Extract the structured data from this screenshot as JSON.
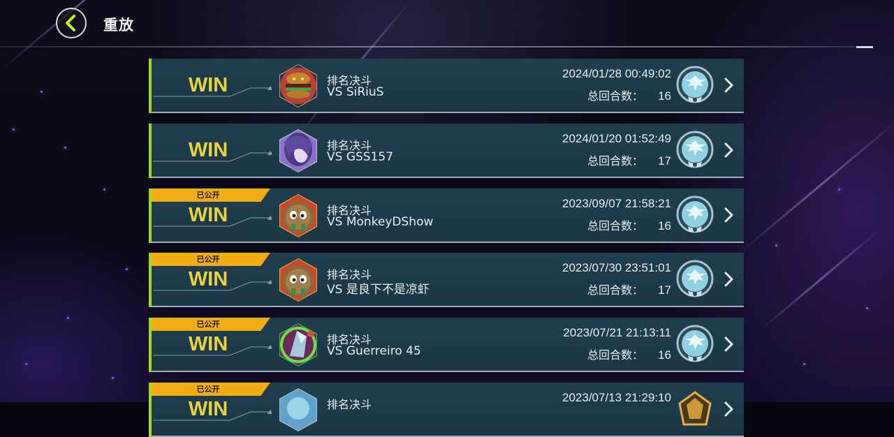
{
  "header": {
    "title": "重放"
  },
  "colors": {
    "accent_green": "#9fdc1a",
    "win_yellow": "#e8d33a",
    "tag_orange": "#f2ac14",
    "row_bg": "#1f3f4f"
  },
  "replays": [
    {
      "public_tag": "",
      "result": "WIN",
      "mode": "排名决斗",
      "opponent": "VS SiRiuS",
      "datetime": "2024/01/28 00:49:02",
      "turns_label": "总回合数：",
      "turns": "16",
      "avatar_icon": "burger-monster-avatar-icon",
      "rank_icon": "rank-emblem-icon"
    },
    {
      "public_tag": "",
      "result": "WIN",
      "mode": "排名决斗",
      "opponent": "VS GSS157",
      "datetime": "2024/01/20 01:52:49",
      "turns_label": "总回合数：",
      "turns": "17",
      "avatar_icon": "purple-girl-avatar-icon",
      "rank_icon": "rank-emblem-icon"
    },
    {
      "public_tag": "已公开",
      "result": "WIN",
      "mode": "排名决斗",
      "opponent": "VS MonkeyDShow",
      "datetime": "2023/09/07 21:58:21",
      "turns_label": "总回合数：",
      "turns": "16",
      "avatar_icon": "kuriboh-avatar-icon",
      "rank_icon": "rank-emblem-icon"
    },
    {
      "public_tag": "已公开",
      "result": "WIN",
      "mode": "排名决斗",
      "opponent": "VS 是良下不是凉虾",
      "datetime": "2023/07/30 23:51:01",
      "turns_label": "总回合数：",
      "turns": "17",
      "avatar_icon": "kuriboh-avatar-icon",
      "rank_icon": "rank-emblem-icon"
    },
    {
      "public_tag": "已公开",
      "result": "WIN",
      "mode": "排名决斗",
      "opponent": "VS Guerreiro 45",
      "datetime": "2023/07/21 21:13:11",
      "turns_label": "总回合数：",
      "turns": "16",
      "avatar_icon": "crystal-dragon-avatar-icon",
      "rank_icon": "rank-emblem-icon"
    },
    {
      "public_tag": "已公开",
      "result": "WIN",
      "mode": "排名决斗",
      "opponent": "",
      "datetime": "2023/07/13 21:29:10",
      "turns_label": "",
      "turns": "",
      "avatar_icon": "blue-avatar-icon",
      "rank_icon": "gold-rank-emblem-icon"
    }
  ]
}
